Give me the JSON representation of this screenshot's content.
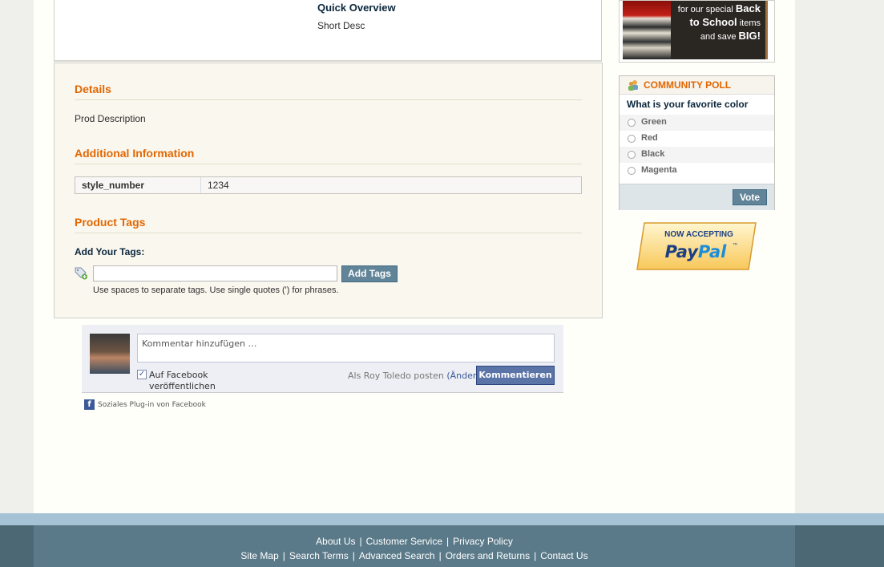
{
  "product": {
    "quick_overview_title": "Quick Overview",
    "short_desc": "Short Desc"
  },
  "collateral": {
    "details_title": "Details",
    "description": "Prod Description",
    "additional_title": "Additional Information",
    "attributes": [
      {
        "label": "style_number",
        "value": "1234"
      }
    ],
    "tags_title": "Product Tags",
    "add_tags_label": "Add Your Tags:",
    "tag_input_value": "",
    "add_tags_button": "Add Tags",
    "tag_hint": "Use spaces to separate tags. Use single quotes (') for phrases."
  },
  "facebook": {
    "comment_placeholder": "Kommentar hinzufügen …",
    "post_checkbox_label": "Auf Facebook veröffentlichen",
    "post_checked": true,
    "posting_as": "Als Roy Toledo posten",
    "change_link": "(Ändern)",
    "submit_button": "Kommentieren",
    "plugin_label": "Soziales Plug-in von Facebook"
  },
  "promo": {
    "line1_pre": "for our special ",
    "line1_bold": "Back",
    "line2_bold": "to School",
    "line2_post": " items",
    "line3_pre": "and save ",
    "line3_bold": "BIG!"
  },
  "poll": {
    "title": "COMMUNITY POLL",
    "question": "What is your favorite color",
    "options": [
      "Green",
      "Red",
      "Black",
      "Magenta"
    ],
    "vote_button": "Vote"
  },
  "paypal": {
    "line1": "NOW ACCEPTING",
    "brand_pay": "Pay",
    "brand_pal": "Pal",
    "tm": "™"
  },
  "footer": {
    "row1": [
      "About Us",
      "Customer Service",
      "Privacy Policy"
    ],
    "row2": [
      "Site Map",
      "Search Terms",
      "Advanced Search",
      "Orders and Returns",
      "Contact Us"
    ]
  },
  "colors": {
    "accent_orange": "#e26703",
    "heading_navy": "#0a263c",
    "button_blue": "#618499",
    "facebook_blue": "#3b5998",
    "footer_bg": "#5b7a89"
  }
}
